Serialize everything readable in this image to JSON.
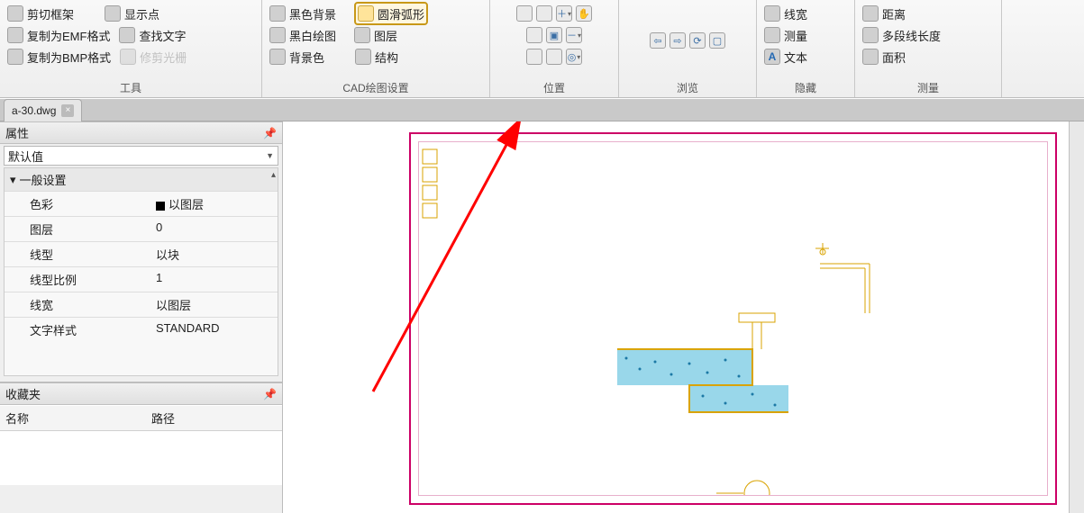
{
  "ribbon": {
    "groups": {
      "tools": {
        "label": "工具",
        "items": [
          {
            "label": "剪切框架",
            "icon": "cut-frame-icon"
          },
          {
            "label": "显示点",
            "icon": "show-points-icon"
          },
          {
            "label": "复制为EMF格式",
            "icon": "copy-emf-icon"
          },
          {
            "label": "查找文字",
            "icon": "find-text-icon"
          },
          {
            "label": "复制为BMP格式",
            "icon": "copy-bmp-icon"
          },
          {
            "label": "修剪光栅",
            "icon": "trim-raster-icon"
          }
        ]
      },
      "cad_settings": {
        "label": "CAD绘图设置",
        "items": [
          {
            "label": "黑色背景",
            "icon": "black-bg-icon"
          },
          {
            "label": "圆滑弧形",
            "icon": "smooth-arc-icon",
            "highlighted": true
          },
          {
            "label": "黑白绘图",
            "icon": "bw-draw-icon"
          },
          {
            "label": "图层",
            "icon": "layers-icon"
          },
          {
            "label": "背景色",
            "icon": "bg-color-icon"
          },
          {
            "label": "结构",
            "icon": "structure-icon"
          }
        ]
      },
      "position": {
        "label": "位置"
      },
      "browse": {
        "label": "浏览"
      },
      "hide": {
        "label": "隐藏",
        "items": [
          {
            "label": "线宽",
            "icon": "linewidth-icon"
          },
          {
            "label": "测量",
            "icon": "measure-icon"
          },
          {
            "label": "文本",
            "icon": "text-icon"
          }
        ]
      },
      "measure": {
        "label": "测量",
        "items": [
          {
            "label": "距离",
            "icon": "distance-icon"
          },
          {
            "label": "多段线长度",
            "icon": "polyline-length-icon"
          },
          {
            "label": "面积",
            "icon": "area-icon"
          }
        ]
      }
    }
  },
  "file_tab": {
    "name": "a-30.dwg"
  },
  "properties_panel": {
    "title": "属性",
    "combo": "默认值",
    "section": "一般设置",
    "rows": [
      {
        "key": "色彩",
        "value": "以图层",
        "swatch": true
      },
      {
        "key": "图层",
        "value": "0"
      },
      {
        "key": "线型",
        "value": "以块"
      },
      {
        "key": "线型比例",
        "value": "1"
      },
      {
        "key": "线宽",
        "value": "以图层"
      },
      {
        "key": "文字样式",
        "value": "STANDARD"
      }
    ]
  },
  "favorites_panel": {
    "title": "收藏夹",
    "cols": {
      "name": "名称",
      "path": "路径"
    }
  }
}
